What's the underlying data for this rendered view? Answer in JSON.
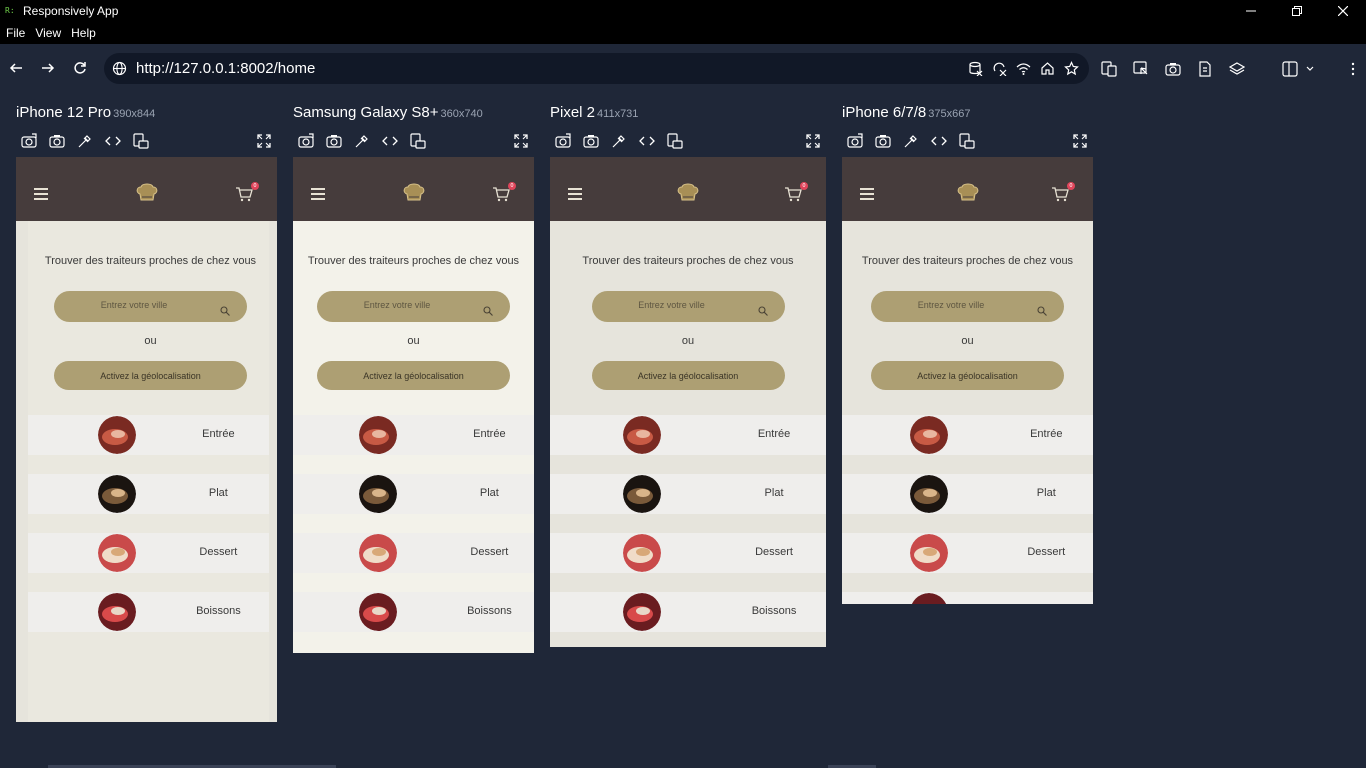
{
  "window": {
    "app_logo": "R:",
    "title": "Responsively App",
    "controls": [
      "minimize-icon",
      "restore-icon",
      "close-icon"
    ]
  },
  "menu": [
    "File",
    "View",
    "Help"
  ],
  "toolbar": {
    "url": "http://127.0.0.1:8002/home",
    "nav_icons": [
      "back-icon",
      "forward-icon",
      "reload-icon"
    ],
    "url_icons": [
      "clear-cache-icon",
      "disable-css-icon",
      "network-icon",
      "home-icon",
      "bookmark-star-icon"
    ],
    "right_icons": [
      "preview-layout-icon",
      "inspect-icon",
      "screenshot-icon",
      "rotate-icon",
      "layers-icon",
      "layout-dropdown-icon",
      "more-menu-icon"
    ]
  },
  "app": {
    "hero_text": "Trouver des traiteurs proches de chez vous",
    "search_placeholder": "Entrez votre ville",
    "or_text": "ou",
    "geo_button": "Activez la géolocalisation",
    "cart_count": "0",
    "categories": [
      "Entrée",
      "Plat",
      "Dessert",
      "Boissons"
    ]
  },
  "devices": [
    {
      "name": "iPhone 12 Pro",
      "size": "390x844"
    },
    {
      "name": "Samsung Galaxy S8+",
      "size": "360x740"
    },
    {
      "name": "Pixel 2",
      "size": "411x731"
    },
    {
      "name": "iPhone 6/7/8",
      "size": "375x667"
    }
  ],
  "colors": {
    "background": "#1f2738",
    "app_header": "#463c3c",
    "pill": "#ad9f73",
    "page": "#eae8df",
    "badge": "#e0455b"
  }
}
